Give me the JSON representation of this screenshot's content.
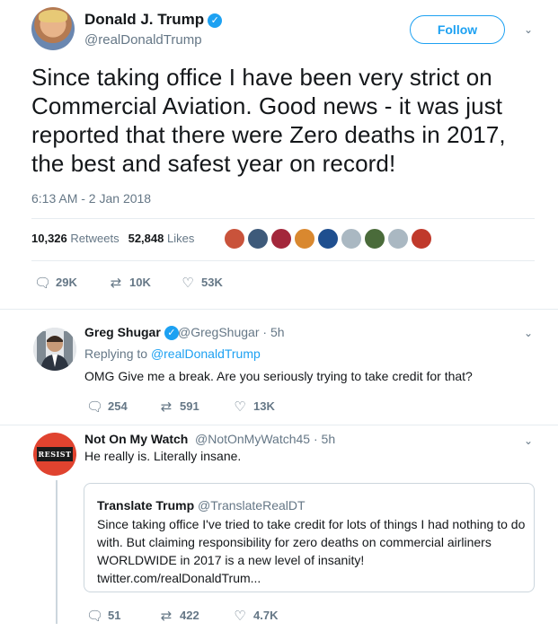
{
  "main_tweet": {
    "author_name": "Donald J. Trump",
    "author_handle": "@realDonaldTrump",
    "follow_label": "Follow",
    "text": "Since taking office I have been very strict on Commercial Aviation. Good news - it was just reported that there were Zero deaths in 2017, the best and safest year on record!",
    "timestamp": "6:13 AM - 2 Jan 2018",
    "retweets_count": "10,326",
    "retweets_label": "Retweets",
    "likes_count": "52,848",
    "likes_label": "Likes",
    "liker_colors": [
      "#c9533b",
      "#3e5a7a",
      "#a3273b",
      "#d9882f",
      "#1f4f8f",
      "#aab8c2",
      "#4a6b3a",
      "#aab8c2",
      "#c0392b"
    ],
    "actions": {
      "replies": "29K",
      "retweets": "10K",
      "likes": "53K"
    }
  },
  "replies": [
    {
      "name": "Greg Shugar",
      "handle": "@GregShugar",
      "time": "5h",
      "replying_prefix": "Replying to",
      "replying_to": "@realDonaldTrump",
      "text": "OMG Give me a break. Are you seriously trying to take credit for that?",
      "actions": {
        "replies": "254",
        "retweets": "591",
        "likes": "13K"
      }
    },
    {
      "name": "Not On My Watch",
      "handle": "@NotOnMyWatch45",
      "time": "5h",
      "avatar_text": "RESIST",
      "text": "He really is. Literally insane.",
      "quote": {
        "name": "Translate Trump",
        "handle": "@TranslateRealDT",
        "text": "Since taking office I've tried to take credit for lots of things I had nothing to do with. But claiming responsibility for zero deaths on commercial airliners WORLDWIDE in 2017 is a new level of insanity!",
        "link": "twitter.com/realDonaldTrum..."
      },
      "actions": {
        "replies": "51",
        "retweets": "422",
        "likes": "4.7K"
      }
    }
  ],
  "icons": {
    "verified": "verified-badge-icon",
    "caret": "chevron-down-icon",
    "reply": "reply-icon",
    "retweet": "retweet-icon",
    "like": "heart-icon"
  },
  "colors": {
    "accent": "#1da1f2",
    "muted": "#657786",
    "text": "#14171a",
    "divider": "#e6ecf0"
  }
}
